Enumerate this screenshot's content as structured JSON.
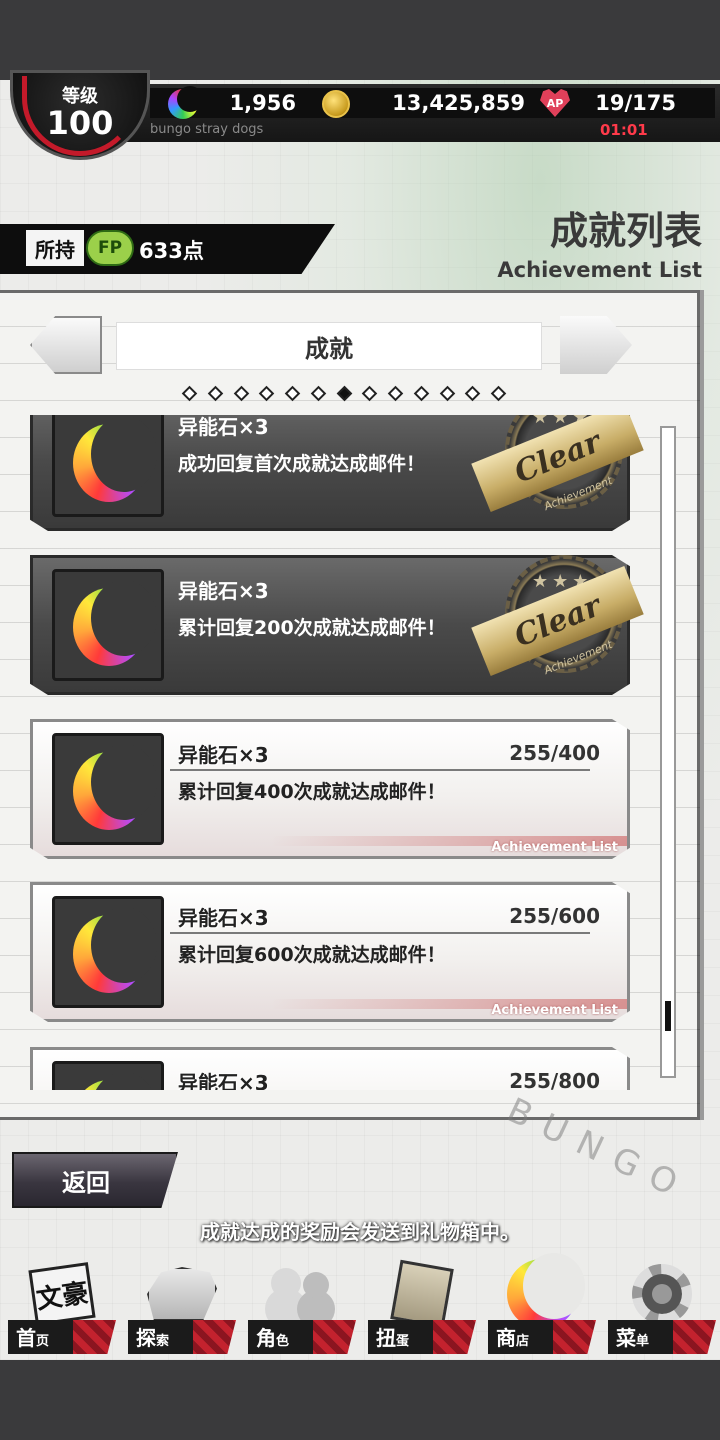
{
  "header": {
    "level_label": "等级",
    "level_value": "100",
    "stones": "1,956",
    "coins": "13,425,859",
    "ap_icon_label": "AP",
    "ap": "19/175",
    "ap_timer": "01:01",
    "brand_sub": "bungo stray dogs"
  },
  "fp": {
    "label": "所持",
    "icon_text": "FP",
    "points": "633点"
  },
  "title": {
    "main": "成就列表",
    "sub": "Achievement List"
  },
  "tabs": {
    "current": "成就",
    "page_count": 13,
    "active_index": 6
  },
  "achievements": [
    {
      "reward": "异能石×3",
      "description": "成功回复首次成就达成邮件！",
      "status": "clear",
      "progress": "",
      "footer": ""
    },
    {
      "reward": "异能石×3",
      "description": "累计回复200次成就达成邮件！",
      "status": "clear",
      "progress": "",
      "footer": ""
    },
    {
      "reward": "异能石×3",
      "description": "累计回复400次成就达成邮件！",
      "status": "in_progress",
      "progress": "255/400",
      "footer": "Achievement List"
    },
    {
      "reward": "异能石×3",
      "description": "累计回复600次成就达成邮件！",
      "status": "in_progress",
      "progress": "255/600",
      "footer": "Achievement List"
    },
    {
      "reward": "异能石×3",
      "description": "",
      "status": "in_progress",
      "progress": "255/800",
      "footer": ""
    }
  ],
  "seal": {
    "text": "Clear",
    "sub": "Achievement",
    "stars": "★★★"
  },
  "scroll": {
    "position": 0.93
  },
  "back_label": "返回",
  "notice": "成就达成的奖励会发送到礼物箱中。",
  "bg_letters": "BUNGO",
  "nav": [
    {
      "label": "首",
      "small": "页",
      "icon": "bunko-icon",
      "glyph": "文豪"
    },
    {
      "label": "探",
      "small": "索",
      "icon": "tiger-icon",
      "glyph": ""
    },
    {
      "label": "角",
      "small": "色",
      "icon": "characters-icon",
      "glyph": ""
    },
    {
      "label": "扭",
      "small": "蛋",
      "icon": "gacha-book-icon",
      "glyph": ""
    },
    {
      "label": "商",
      "small": "店",
      "icon": "ability-stone-icon",
      "glyph": ""
    },
    {
      "label": "菜",
      "small": "单",
      "icon": "gear-icon",
      "glyph": ""
    }
  ],
  "colors": {
    "accent_red": "#c41a2a",
    "fp_green": "#9bd04a",
    "timer_red": "#ff3a4a"
  }
}
